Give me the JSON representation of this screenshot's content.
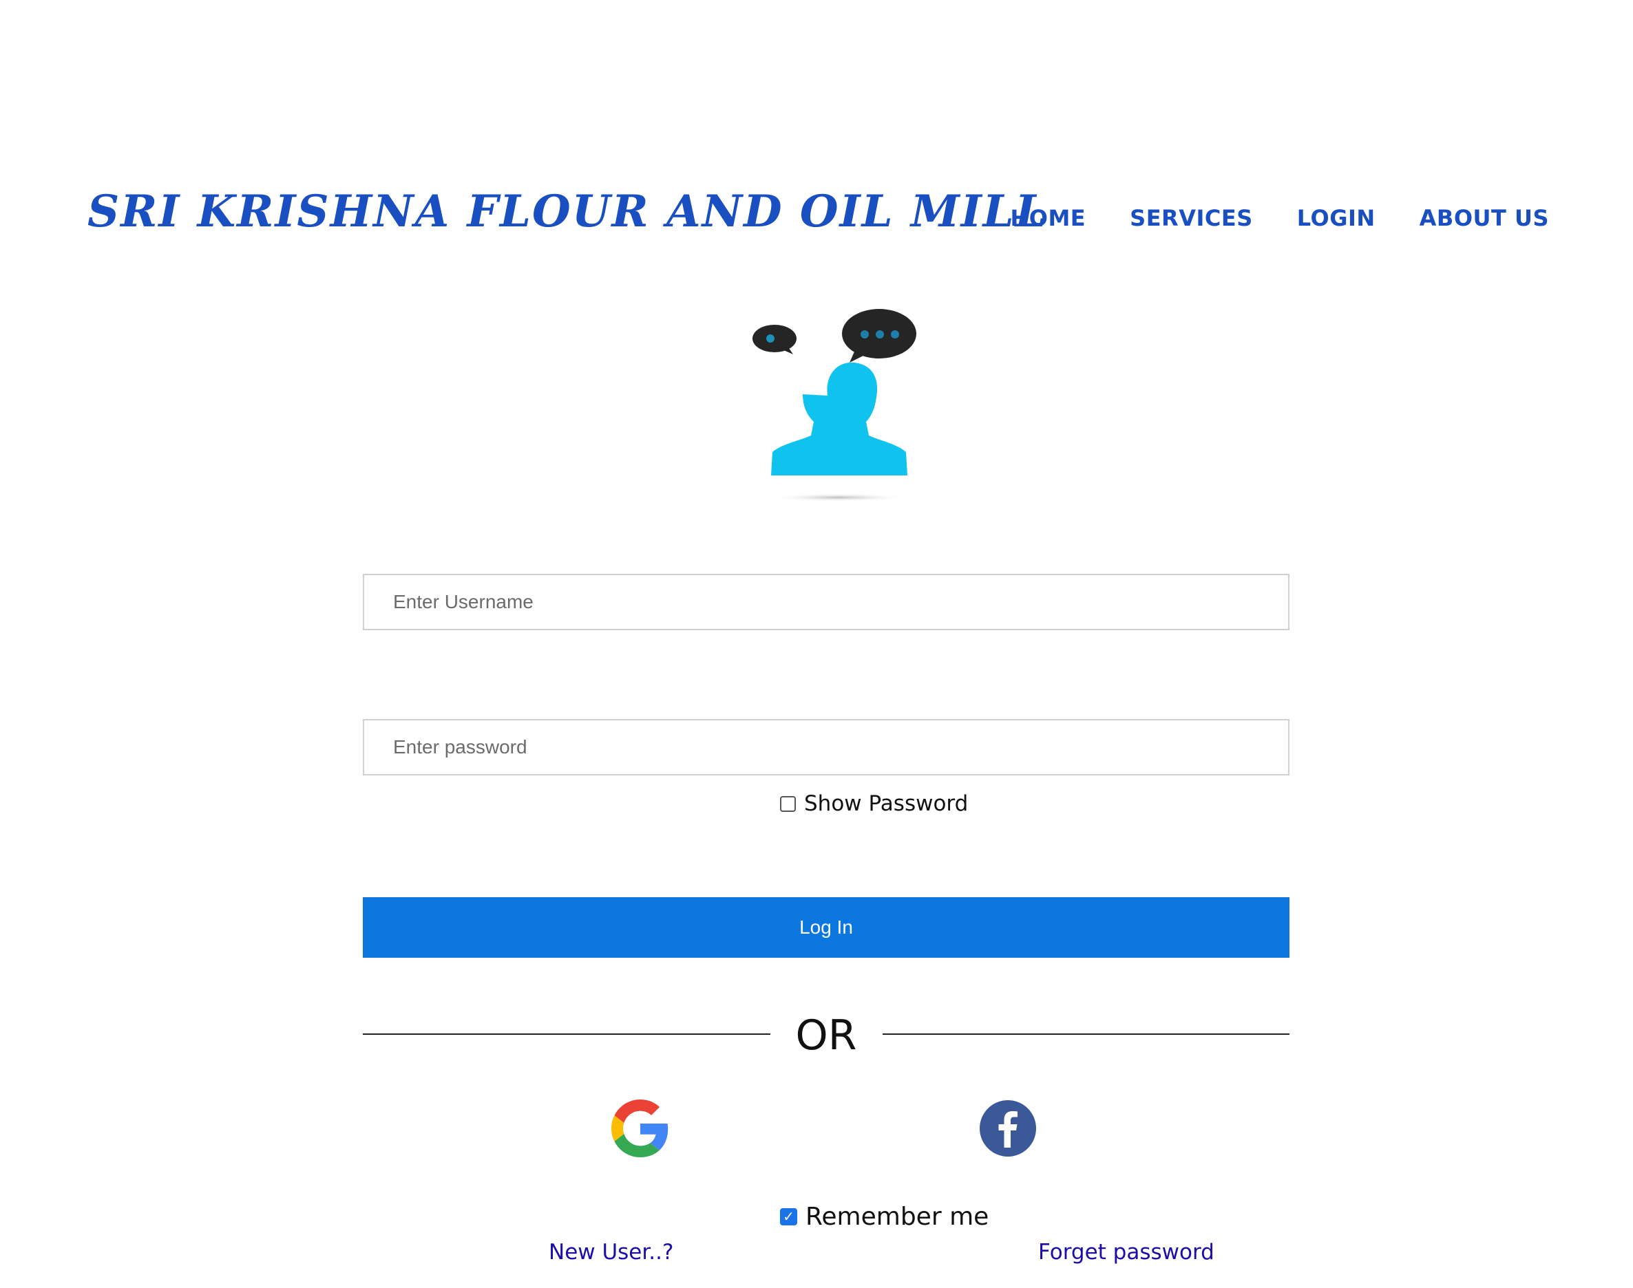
{
  "header": {
    "brand": "SRI KRISHNA FLOUR AND OIL MILL",
    "nav": [
      "HOME",
      "SERVICES",
      "LOGIN",
      "ABOUT US"
    ]
  },
  "form": {
    "username_placeholder": "Enter Username",
    "password_placeholder": "Enter password",
    "show_password_label": "Show Password",
    "show_password_checked": false,
    "login_label": "Log In",
    "or_label": "OR",
    "remember_label": "Remember me",
    "remember_checked": true,
    "new_user_label": "New User..?",
    "forget_label": "Forget password"
  },
  "icons": {
    "hero": "user-chat-icon",
    "google": "google-icon",
    "facebook": "facebook-icon"
  },
  "colors": {
    "brand": "#1a4fc2",
    "button": "#0b76dd",
    "hero_user": "#10c2ee",
    "facebook": "#3b5998",
    "link": "#1a0dab"
  }
}
